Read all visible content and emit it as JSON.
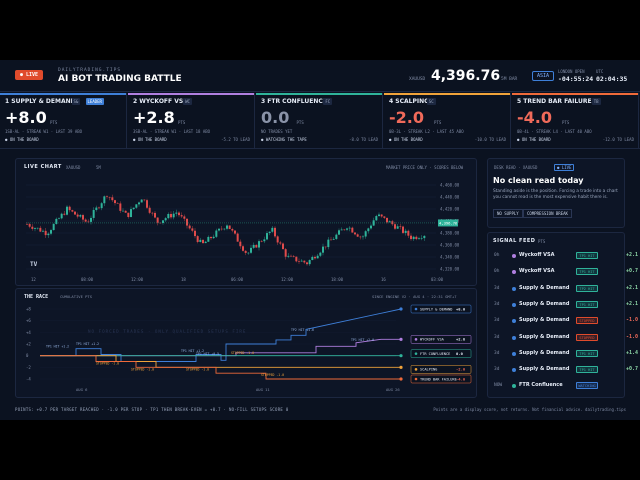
{
  "header": {
    "live_label": "● LIVE",
    "brand_sub": "DAILYTRADING.TIPS",
    "title": "AI BOT TRADING BATTLE",
    "symbol": "XAUUSD",
    "price": "4,396.76",
    "timeframe": "5M BAR",
    "session": "ASIA",
    "london_label": "LONDON OPEN",
    "london_value": "-04:55:24",
    "utc_label": "UTC",
    "utc_value": "02:04:35"
  },
  "bots": [
    {
      "rank": "1",
      "name": "SUPPLY & DEMAND",
      "badge1": "S&",
      "badge2": "LEADER",
      "score": "+8.0",
      "unit": "PTS",
      "meta": "1SB-AL · STREAK W1 · LAST 39 ABO",
      "status": "● ON THE BOARD",
      "lead": "",
      "color": "#3e7fd8"
    },
    {
      "rank": "2",
      "name": "WYCKOFF VSA",
      "badge1": "WC",
      "badge2": "",
      "score": "+2.8",
      "unit": "PTS",
      "meta": "3SB-AL · STREAK W1 · LAST 18 ABO",
      "status": "● ON THE BOARD",
      "lead": "-5.2 TO LEAD",
      "color": "#b07fe0"
    },
    {
      "rank": "3",
      "name": "FTR CONFLUENCE",
      "badge1": "FC",
      "badge2": "",
      "score": "0.0",
      "unit": "PTS",
      "meta": "NO TRADES YET",
      "status": "● WATCHING THE TAPE",
      "lead": "-8.0 TO LEAD",
      "color": "#2fb39a"
    },
    {
      "rank": "4",
      "name": "SCALPING",
      "badge1": "SC",
      "badge2": "",
      "score": "-2.0",
      "unit": "PTS",
      "meta": "0B-3L · STREAK L2 · LAST 45 ABO",
      "status": "● ON THE BOARD",
      "lead": "-10.0 TO LEAD",
      "color": "#f0a33a"
    },
    {
      "rank": "5",
      "name": "TREND BAR FAILURE",
      "badge1": "TB",
      "badge2": "",
      "score": "-4.0",
      "unit": "PTS",
      "meta": "0B-4L · STREAK L4 · LAST 40 ABO",
      "status": "● ON THE BOARD",
      "lead": "-12.0 TO LEAD",
      "color": "#f06a3a"
    }
  ],
  "live_chart": {
    "title": "LIVE CHART",
    "tag1": "XAUUSD",
    "tag2": "5M",
    "note": "MARKET PRICE ONLY · SCORES BELOW",
    "price_tag": "4,396.76",
    "y_ticks": [
      "4,460.00",
      "4,440.00",
      "4,420.00",
      "4,400.00",
      "4,380.00",
      "4,360.00",
      "4,340.00",
      "4,320.00"
    ],
    "x_ticks": [
      "12",
      "08:00",
      "12:00",
      "18",
      "06:00",
      "12:00",
      "18:00",
      "16",
      "03:00"
    ],
    "tv_logo": "TV"
  },
  "chart_data": {
    "type": "line",
    "title": "THE RACE",
    "subtitle": "CUMULATIVE PTS",
    "note": "SINCE ENGINE V2 · AUG 4 · 22:31 GMT+7",
    "watermark": "NO FORCED TRADES · ONLY QUALIFIED SETUPS FIRE",
    "y_ticks": [
      "+8",
      "+6",
      "+4",
      "+2",
      "0",
      "-2",
      "-4"
    ],
    "x_labels": [
      "AUG 6",
      "AUG 11",
      "AUG 26"
    ],
    "annotations": [
      "TP1 HIT +1.2",
      "TP1 HIT +1.2",
      "STOPPED -1.0",
      "TP2 HIT +1.6",
      "TP1 HIT +1.2",
      "TP1 HIT +0.5",
      "STOPPED -1.0",
      "STOPPED -1.0",
      "STOPPED -1.0",
      "STOPPED -1.0",
      "TP1 HIT +2.0"
    ],
    "series": [
      {
        "name": "SUPPLY & DEMAND",
        "final": "+8.0",
        "color": "#3e7fd8"
      },
      {
        "name": "WYCKOFF VSA",
        "final": "+2.8",
        "color": "#b07fe0"
      },
      {
        "name": "FTR CONFLUENCE",
        "final": "0.0",
        "color": "#2fb39a"
      },
      {
        "name": "SCALPING",
        "final": "-2.0",
        "color": "#f0a33a"
      },
      {
        "name": "TREND BAR FAILURE",
        "final": "-4.0",
        "color": "#f06a3a"
      }
    ]
  },
  "desk": {
    "title": "DESK READ · XAUUSD",
    "live": "● LIVE",
    "headline": "No clean read today",
    "body": "Standing aside is the position. Forcing a trade into a chart you cannot read is the most expensive habit there is.",
    "chip1": "NO SUPPLY",
    "chip2": "COMPRESSION BREAK"
  },
  "feed": {
    "title": "SIGNAL FEED",
    "count": "PTS",
    "rows": [
      {
        "time": "0h",
        "name": "Wyckoff VSA",
        "tag": "TP1 HIT",
        "value": "+2.1",
        "color": "#b07fe0",
        "tag_color": "#2fb39a",
        "val_color": "#8fd9a8"
      },
      {
        "time": "0h",
        "name": "Wyckoff VSA",
        "tag": "TP1 HIT",
        "value": "+0.7",
        "color": "#b07fe0",
        "tag_color": "#2fb39a",
        "val_color": "#8fd9a8"
      },
      {
        "time": "3d",
        "name": "Supply & Demand",
        "tag": "TP2 HIT",
        "value": "+2.1",
        "color": "#3e7fd8",
        "tag_color": "#2fb39a",
        "val_color": "#8fd9a8"
      },
      {
        "time": "3d",
        "name": "Supply & Demand",
        "tag": "TP1 HIT",
        "value": "+2.1",
        "color": "#3e7fd8",
        "tag_color": "#2fb39a",
        "val_color": "#8fd9a8"
      },
      {
        "time": "3d",
        "name": "Supply & Demand",
        "tag": "STOPPED",
        "value": "-1.0",
        "color": "#3e7fd8",
        "tag_color": "#e04b2c",
        "val_color": "#f06a5a"
      },
      {
        "time": "3d",
        "name": "Supply & Demand",
        "tag": "STOPPED",
        "value": "-1.0",
        "color": "#3e7fd8",
        "tag_color": "#e04b2c",
        "val_color": "#f06a5a"
      },
      {
        "time": "3d",
        "name": "Supply & Demand",
        "tag": "TP1 HIT",
        "value": "+1.4",
        "color": "#3e7fd8",
        "tag_color": "#2fb39a",
        "val_color": "#8fd9a8"
      },
      {
        "time": "3d",
        "name": "Supply & Demand",
        "tag": "TP1 HIT",
        "value": "+0.7",
        "color": "#3e7fd8",
        "tag_color": "#2fb39a",
        "val_color": "#8fd9a8"
      },
      {
        "time": "NOW",
        "name": "FTR Confluence",
        "tag": "WATCHING",
        "value": "",
        "color": "#2fb39a",
        "tag_color": "#3e7fd8",
        "val_color": "#7f8aa3"
      }
    ]
  },
  "footer": {
    "scoring": "POINTS: +0.7 PER TARGET REACHED · -1.0 PER STOP · TP1 THEN BREAK-EVEN = +0.7 · NO-FILL SETUPS SCORE 0",
    "disclaimer": "Points are a display score, not returns. Not financial advice. dailytrading.tips"
  }
}
